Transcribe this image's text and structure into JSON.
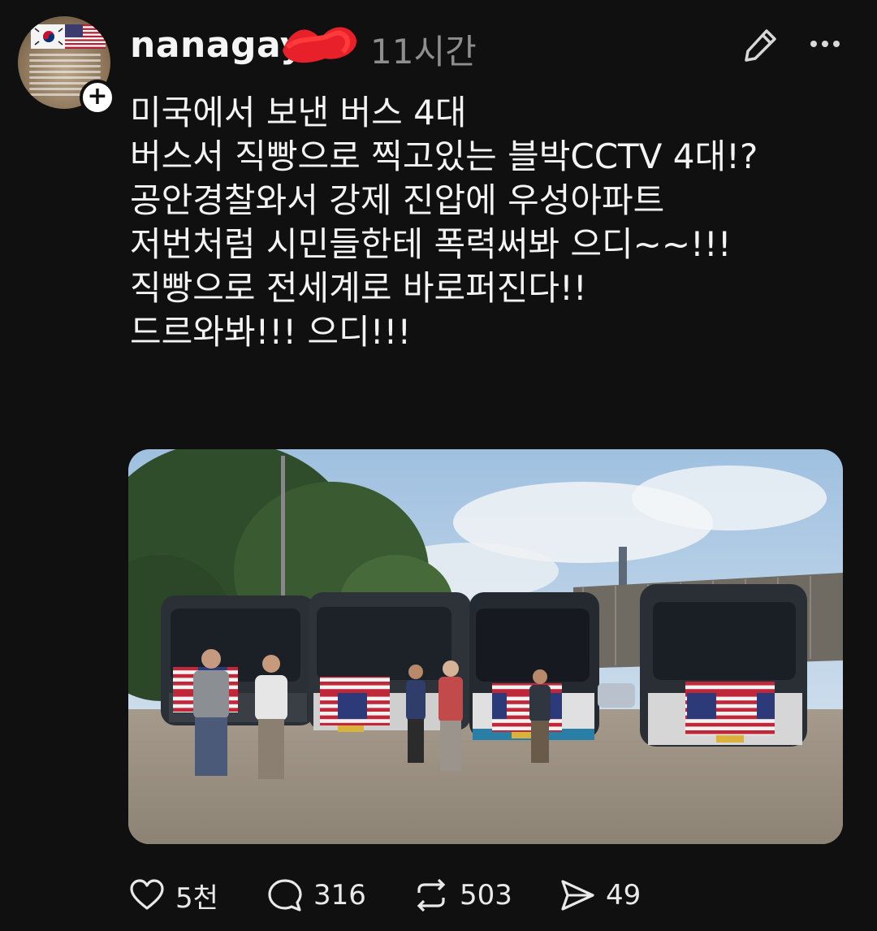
{
  "post": {
    "username": "nanagay",
    "time": "11시간",
    "lines": [
      "미국에서 보낸 버스 4대",
      "버스서 직빵으로 찍고있는 블박CCTV 4대!?",
      "공안경찰와서 강제 진압에 우성아파트",
      "저번처럼 시민들한테 폭력써봐 으디~~!!!",
      "직빵으로 전세계로 바로퍼진다!!",
      "드르와봐!!! 으디!!!"
    ]
  },
  "actions": {
    "likes": "5천",
    "replies": "316",
    "reposts": "503",
    "shares": "49"
  },
  "icons": {
    "avatar": "avatar-image",
    "follow": "plus-icon",
    "edit": "pencil-icon",
    "more": "more-dots-icon",
    "like": "heart-icon",
    "reply": "comment-icon",
    "repost": "repost-icon",
    "share": "send-icon"
  },
  "colors": {
    "background": "#101010",
    "text": "#f3f3f3",
    "muted": "#8e8e8e",
    "redaction": "#e8202a"
  }
}
